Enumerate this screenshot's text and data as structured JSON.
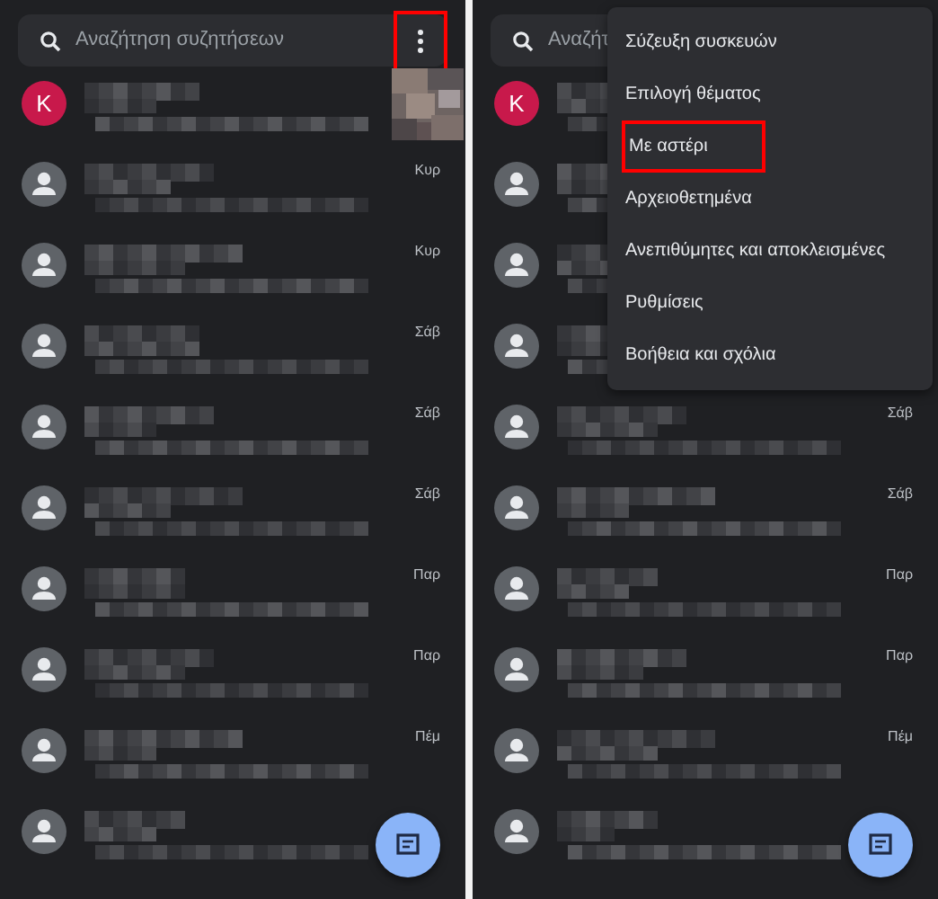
{
  "panels": [
    {
      "search": {
        "placeholder": "Αναζήτηση συζητήσεων"
      },
      "menu_button": {
        "highlighted": true
      },
      "conversations": [
        {
          "avatar": {
            "kind": "letter",
            "letter": "K",
            "color": "#c8194b"
          }
        },
        {
          "avatar": {
            "kind": "person"
          },
          "day": "Κυρ"
        },
        {
          "avatar": {
            "kind": "person"
          },
          "day": "Κυρ"
        },
        {
          "avatar": {
            "kind": "person"
          },
          "day": "Σάβ"
        },
        {
          "avatar": {
            "kind": "person"
          },
          "day": "Σάβ"
        },
        {
          "avatar": {
            "kind": "person"
          },
          "day": "Σάβ"
        },
        {
          "avatar": {
            "kind": "person"
          },
          "day": "Παρ"
        },
        {
          "avatar": {
            "kind": "person"
          },
          "day": "Παρ"
        },
        {
          "avatar": {
            "kind": "person"
          },
          "day": "Πέμ"
        },
        {
          "avatar": {
            "kind": "person"
          }
        }
      ]
    },
    {
      "search": {
        "placeholder": "Αναζήτ"
      },
      "conversations": [
        {
          "avatar": {
            "kind": "letter",
            "letter": "K",
            "color": "#c8194b"
          }
        },
        {
          "avatar": {
            "kind": "person"
          }
        },
        {
          "avatar": {
            "kind": "person"
          }
        },
        {
          "avatar": {
            "kind": "person"
          }
        },
        {
          "avatar": {
            "kind": "person"
          },
          "day": "Σάβ"
        },
        {
          "avatar": {
            "kind": "person"
          },
          "day": "Σάβ"
        },
        {
          "avatar": {
            "kind": "person"
          },
          "day": "Παρ"
        },
        {
          "avatar": {
            "kind": "person"
          },
          "day": "Παρ"
        },
        {
          "avatar": {
            "kind": "person"
          },
          "day": "Πέμ"
        },
        {
          "avatar": {
            "kind": "person"
          }
        }
      ],
      "menu": {
        "items": [
          {
            "label": "Σύζευξη συσκευών",
            "highlighted": false
          },
          {
            "label": "Επιλογή θέματος",
            "highlighted": false
          },
          {
            "label": "Με αστέρι",
            "highlighted": true
          },
          {
            "label": "Αρχειοθετημένα",
            "highlighted": false
          },
          {
            "label": "Ανεπιθύμητες και αποκλεισμένες",
            "highlighted": false
          },
          {
            "label": "Ρυθμίσεις",
            "highlighted": false
          },
          {
            "label": "Βοήθεια και σχόλια",
            "highlighted": false
          }
        ]
      }
    }
  ]
}
